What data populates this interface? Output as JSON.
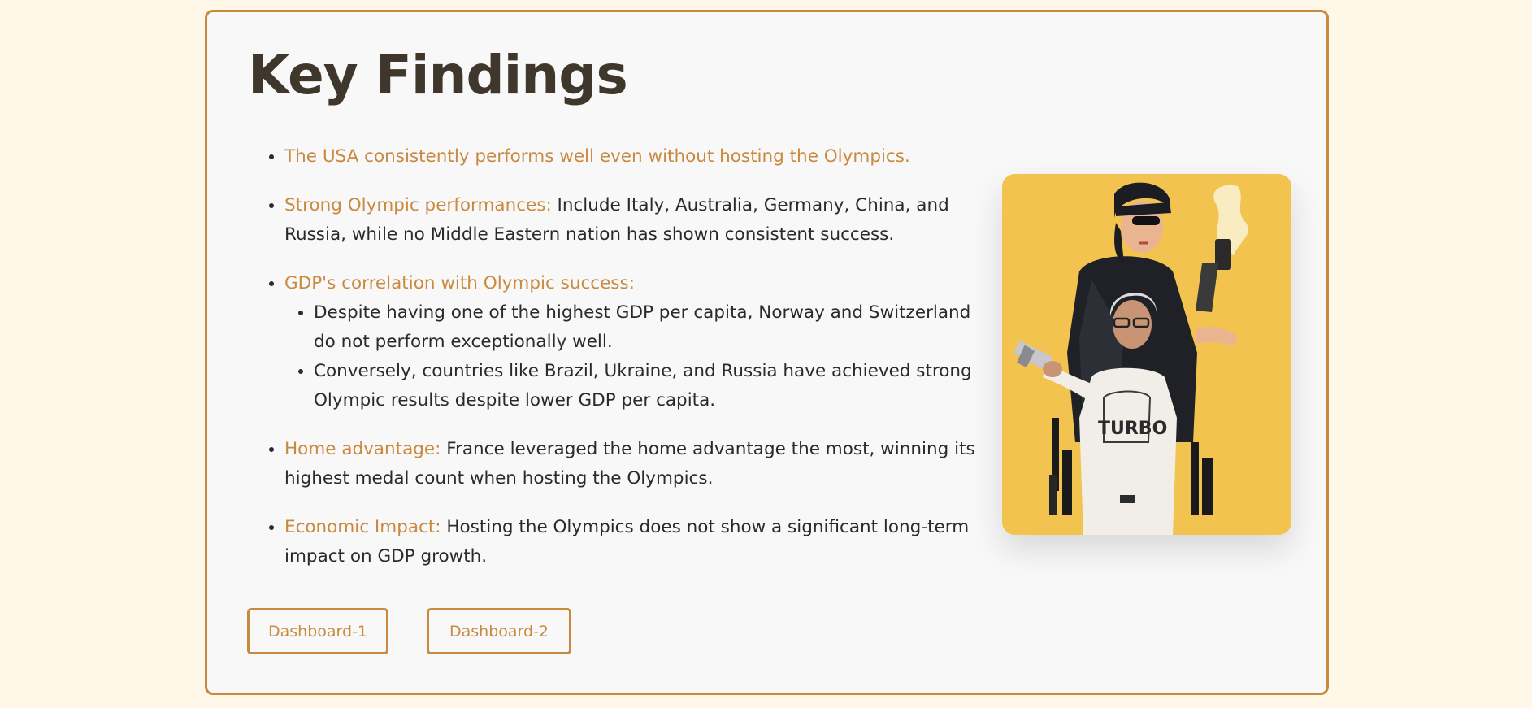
{
  "page": {
    "title": "Key Findings"
  },
  "findings": [
    {
      "highlight": "The USA consistently performs well even without hosting the Olympics.",
      "text": ""
    },
    {
      "highlight": "Strong Olympic performances:",
      "text": " Include Italy, Australia, Germany, China, and Russia, while no Middle Eastern nation has shown consistent success."
    },
    {
      "highlight": "GDP's correlation with Olympic success:",
      "text": "",
      "subitems": [
        "Despite having one of the highest GDP per capita, Norway and Switzerland do not perform exceptionally well.",
        "Conversely, countries like Brazil, Ukraine, and Russia have achieved strong Olympic results despite lower GDP per capita."
      ]
    },
    {
      "highlight": "Home advantage:",
      "text": " France leveraged the home advantage the most, winning its highest medal count when hosting the Olympics."
    },
    {
      "highlight": "Economic Impact:",
      "text": " Hosting the Olympics does not show a significant long-term impact on GDP growth."
    }
  ],
  "buttons": {
    "dashboard_1": "Dashboard-1",
    "dashboard_2": "Dashboard-2"
  },
  "image": {
    "shirt_text": "TURBO"
  },
  "colors": {
    "accent": "#c98a40",
    "page_background": "#fff8e8",
    "card_background": "#f8f8f8",
    "title": "#3f372b",
    "image_background": "#f2c34e"
  }
}
